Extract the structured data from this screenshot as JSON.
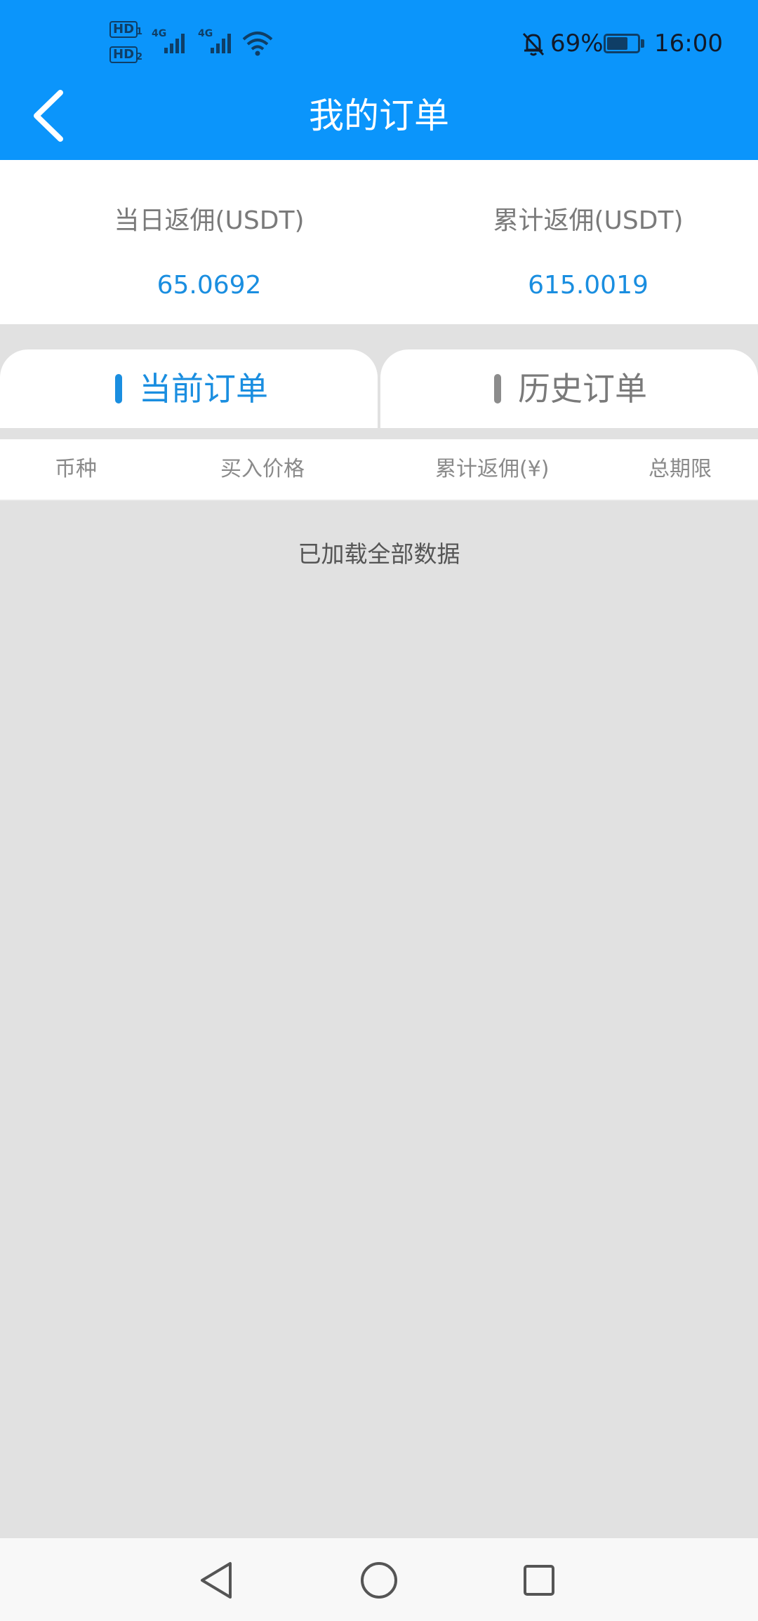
{
  "status_bar": {
    "hd1": "HD",
    "hd1_sub": "1",
    "hd2": "HD",
    "hd2_sub": "2",
    "net1": "4G",
    "net2": "4G",
    "battery_percent": "69%",
    "battery_level": 0.69,
    "time": "16:00",
    "icons": [
      "signal-icon",
      "wifi-icon",
      "bell-off-icon",
      "battery-charging-icon"
    ]
  },
  "header": {
    "title": "我的订单",
    "background_color": "#0b95fb"
  },
  "summary": {
    "daily": {
      "label": "当日返佣(USDT)",
      "value": "65.0692"
    },
    "total": {
      "label": "累计返佣(USDT)",
      "value": "615.0019"
    }
  },
  "tabs": [
    {
      "label": "当前订单",
      "active": true,
      "color": "#1a8ee0"
    },
    {
      "label": "历史订单",
      "active": false,
      "color": "#7a7a7a"
    }
  ],
  "table": {
    "columns": [
      "币种",
      "买入价格",
      "累计返佣(¥)",
      "总期限"
    ]
  },
  "list": {
    "end_message": "已加载全部数据"
  },
  "nav": [
    "back-icon",
    "home-icon",
    "recents-icon"
  ]
}
